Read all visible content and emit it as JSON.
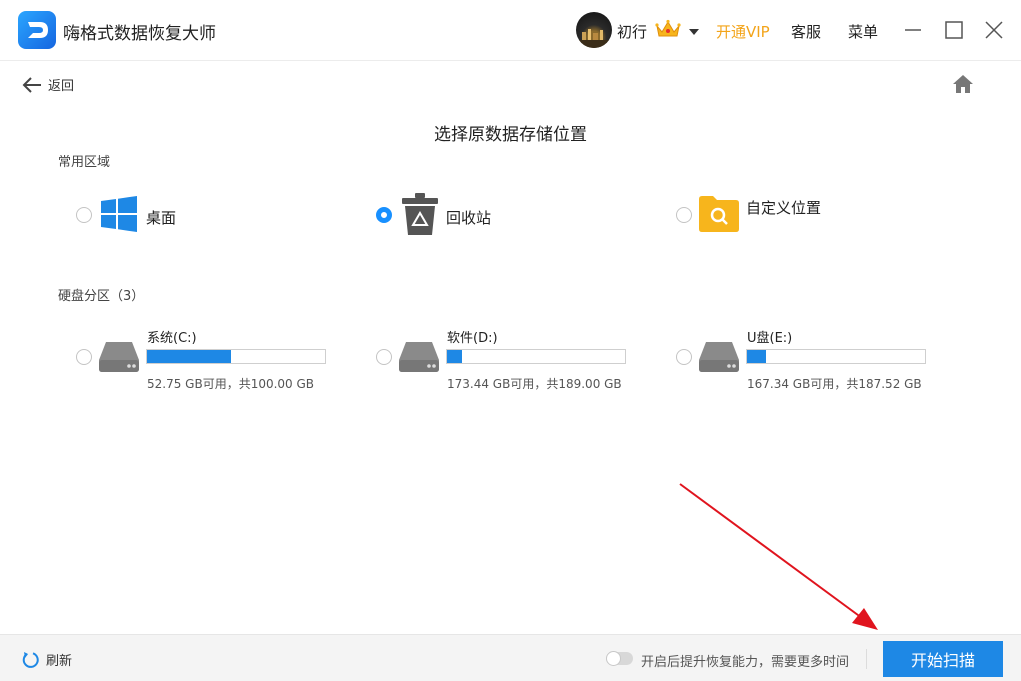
{
  "header": {
    "app_title": "嗨格式数据恢复大师",
    "username": "初行",
    "vip_label": "开通VIP",
    "service_label": "客服",
    "menu_label": "菜单"
  },
  "nav": {
    "back_label": "返回"
  },
  "page_title": "选择原数据存储位置",
  "common": {
    "label": "常用区域",
    "options": [
      {
        "label": "桌面",
        "icon": "windows-icon",
        "selected": false
      },
      {
        "label": "回收站",
        "icon": "recycle-bin-icon",
        "selected": true
      },
      {
        "label": "自定义位置",
        "icon": "folder-search-icon",
        "selected": false
      }
    ]
  },
  "disks": {
    "label": "硬盘分区（3）",
    "items": [
      {
        "name": "系统(C:)",
        "info": "52.75 GB可用，共100.00 GB",
        "used_fraction": 0.4725
      },
      {
        "name": "软件(D:)",
        "info": "173.44 GB可用，共189.00 GB",
        "used_fraction": 0.0823
      },
      {
        "name": "U盘(E:)",
        "info": "167.34 GB可用，共187.52 GB",
        "used_fraction": 0.1076
      }
    ]
  },
  "footer": {
    "refresh_label": "刷新",
    "toggle_label": "开启后提升恢复能力，需要更多时间",
    "toggle_on": false,
    "scan_label": "开始扫描"
  },
  "colors": {
    "accent": "#1e88e5",
    "vip": "#f3a41a",
    "annotation_arrow": "#e0141e"
  }
}
